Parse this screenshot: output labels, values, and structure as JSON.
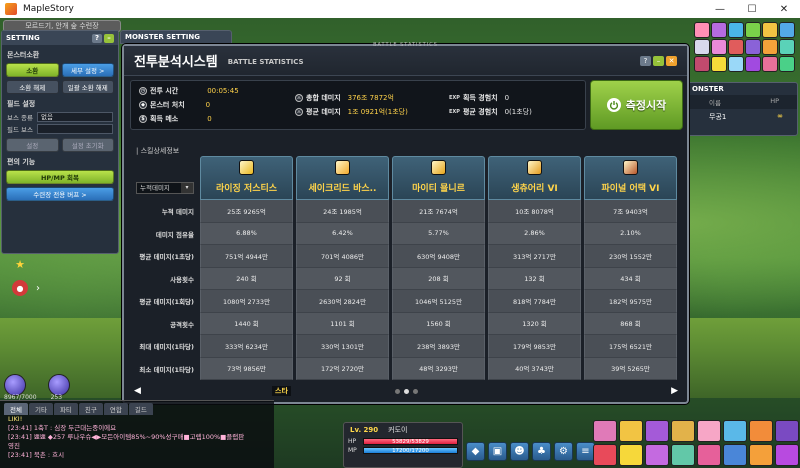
{
  "window": {
    "title": "MapleStory",
    "minimize": "—",
    "maximize": "☐",
    "close": "✕"
  },
  "top_notice": "모르드기, 안개 숲 수련장",
  "setting_panel": {
    "title": "SETTING",
    "monster_summon_title": "몬스터소환",
    "summon_btn": "소환",
    "detail_btn": "세부 설정 >",
    "summon_clear_btn": "소환 해제",
    "bulk_clear_btn": "일괄 소환 해제",
    "field_setting_title": "필드 설정",
    "boss_type_label": "보스 종류",
    "boss_type_value": "없음",
    "field_boss_label": "필드 보스",
    "field_boss_value": "",
    "apply_btn": "설정",
    "reset_btn": "설정 초기화",
    "convenience_title": "편의 기능",
    "hpmp_btn": "HP/MP 회복",
    "training_buff_btn": "수련장 전용 버프 >"
  },
  "monster_setting_tab": "MONSTER SETTING",
  "monster_panel": {
    "title": "ONSTER",
    "col_name": "이름",
    "col_hp": "HP",
    "row_name": "무공1",
    "row_hp": "∞"
  },
  "battle_stats": {
    "tab_label": "BATTLE STATISTICS",
    "title": "전투분석시스템",
    "subtitle": "BATTLE STATISTICS",
    "combat_time_label": "전투 시간",
    "combat_time_value": "00:05:45",
    "monster_kill_label": "몬스터 처치",
    "monster_kill_value": "0",
    "acquire_meso_label": "획득 메소",
    "acquire_meso_value": "0",
    "total_damage_label": "총합 데미지",
    "total_damage_value": "376조 7872억",
    "avg_damage_label": "평균 데미지",
    "avg_damage_value": "1조 0921억(1초당)",
    "exp_acquire_label": "획득 경험치",
    "exp_acquire_value": "0",
    "exp_avg_label": "평균 경험치",
    "exp_avg_value": "0(1초당)",
    "exp_prefix": "EXP",
    "measure_btn": "측정시작",
    "skill_section_title": "| 스킬상세정보",
    "sort_select_value": "누적데미지",
    "sort_arrow": "▾",
    "row_labels": [
      "누적 데미지",
      "데미지 점유율",
      "평균 데미지(1초당)",
      "사용횟수",
      "평균 데미지(1회당)",
      "공격횟수",
      "최대 데미지(1타당)",
      "최소 데미지(1타당)"
    ],
    "skills": [
      {
        "name": "라이징 저스티스",
        "color": "#e9b820",
        "values": [
          "25조 9265억",
          "6.88%",
          "751억 4944만",
          "240 회",
          "1080억 2733만",
          "1440 회",
          "333억 6234만",
          "73억 9856만"
        ]
      },
      {
        "name": "세이크리드 바스..",
        "color": "#f2a92c",
        "values": [
          "24조 1985억",
          "6.42%",
          "701억 4086만",
          "92 회",
          "2630억 2824만",
          "1101 회",
          "330억 1301만",
          "172억 2720만"
        ]
      },
      {
        "name": "마이티 묠니르",
        "color": "#e7a51a",
        "values": [
          "21조 7674억",
          "5.77%",
          "630억 9408만",
          "208 회",
          "1046억 5125만",
          "1560 회",
          "238억 3893만",
          "48억 3293만"
        ]
      },
      {
        "name": "생츄어리 VI",
        "color": "#e59c1e",
        "values": [
          "10조 8078억",
          "2.86%",
          "313억 2717만",
          "132 회",
          "818억 7784만",
          "1320 회",
          "179억 9853만",
          "40억 3743만"
        ]
      },
      {
        "name": "파이널 어택 VI",
        "color": "#b7562a",
        "values": [
          "7조 9403억",
          "2.10%",
          "230억 1552만",
          "434 회",
          "182억 9575만",
          "868 회",
          "175억 6521만",
          "39억 5265만"
        ]
      }
    ],
    "prev_arrow": "◀",
    "next_arrow": "▶",
    "page_count": 3,
    "active_page": 2
  },
  "chat": {
    "tabs": [
      "전체",
      "기타",
      "파티",
      "친구",
      "연합",
      "길드"
    ],
    "lines": [
      {
        "text": "LIKI!",
        "tone": "yellow"
      },
      {
        "text": "[23:41] 1축T : 심장 두근대는중이에요",
        "tone": "pink"
      },
      {
        "text": "[23:41] 뾰뾰 ◆257 루나우슈◀▶모든아이템85%~90%성구매■고렙100%■플랩판",
        "tone": "pink"
      },
      {
        "text": "영진",
        "tone": "pink"
      },
      {
        "text": "[23:41] 북촌 : 흐시",
        "tone": "pink"
      }
    ]
  },
  "orb_values": [
    "8967/7000",
    "253"
  ],
  "character": {
    "name_tag": "스타",
    "level": "Lv. 290",
    "name": "커도이",
    "hp_text": "53829/53829",
    "mp_text": "17200/17200",
    "hp_label": "HP",
    "mp_label": "MP"
  }
}
